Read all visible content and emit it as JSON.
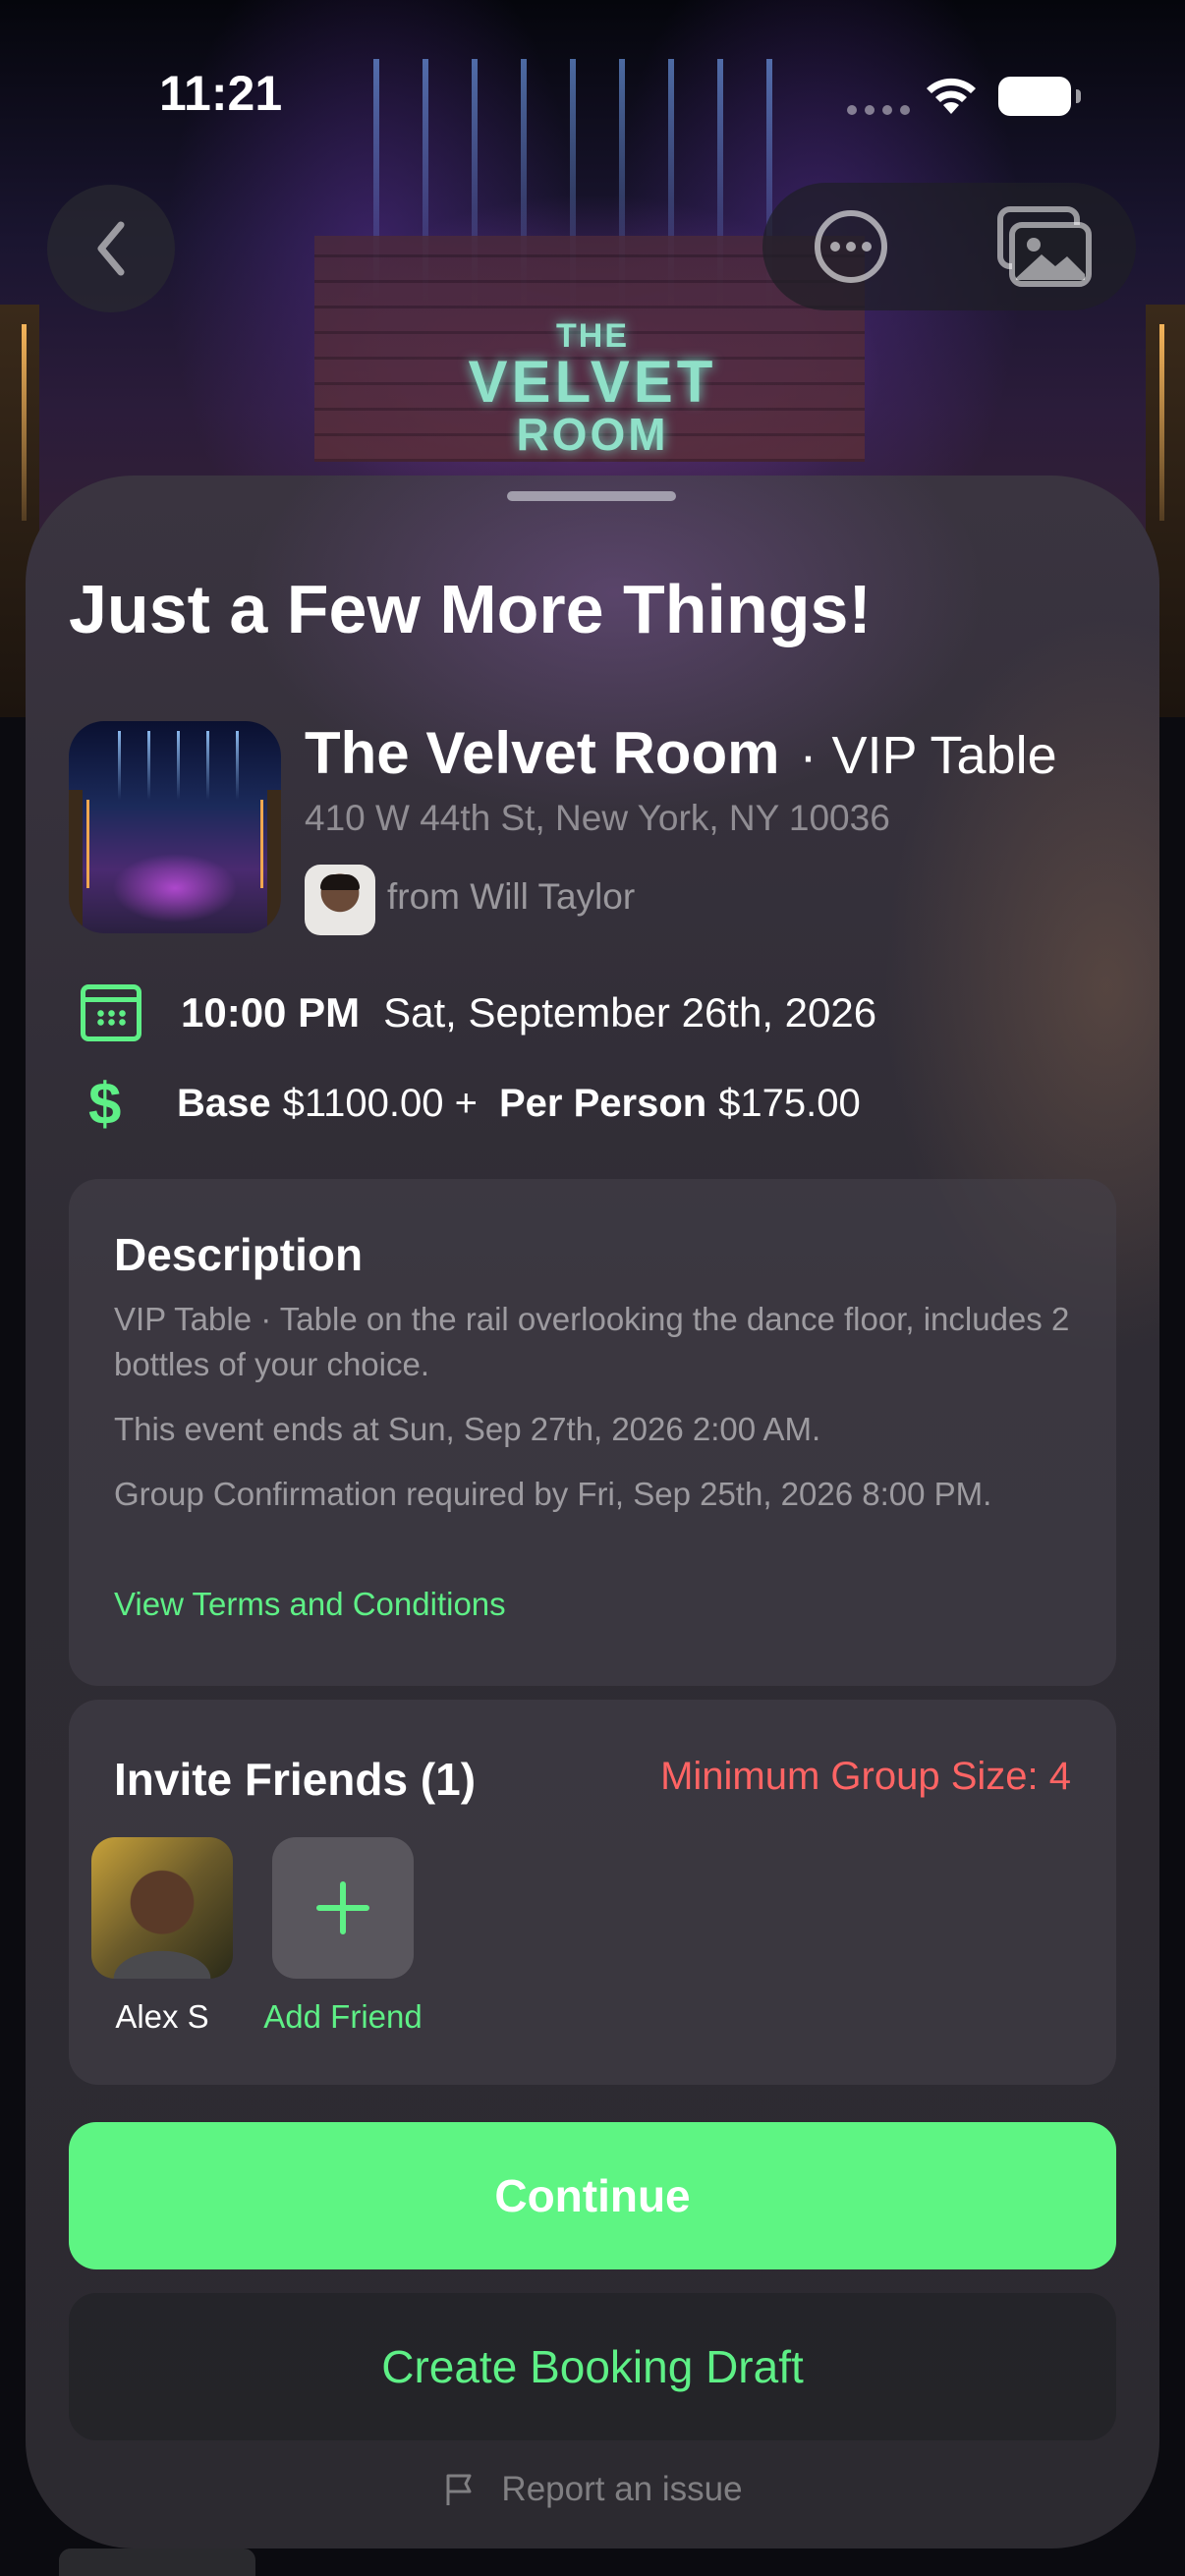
{
  "status_bar": {
    "time": "11:21"
  },
  "hero": {
    "sign_lines": [
      "THE",
      "VELVET",
      "ROOM"
    ]
  },
  "nav": {
    "back_icon": "chevron-left-icon",
    "more_icon": "ellipsis-circle-icon",
    "photos_icon": "photo-gallery-icon"
  },
  "sheet": {
    "title": "Just a Few More Things!",
    "venue": {
      "name": "The Velvet Room",
      "table_type": "· VIP Table",
      "address": "410 W 44th St, New York, NY 10036",
      "host_label": "from Will Taylor"
    },
    "schedule": {
      "time": "10:00 PM",
      "date": "Sat, September 26th, 2026"
    },
    "pricing": {
      "base_label": "Base",
      "base_value": "$1100.00 +",
      "per_person_label": "Per Person",
      "per_person_value": "$175.00"
    },
    "description": {
      "title": "Description",
      "body": "VIP Table · Table on the rail overlooking the dance floor, includes 2 bottles of your choice.",
      "end_note": "This event ends at Sun, Sep 27th, 2026 2:00 AM.",
      "confirmation_note": "Group Confirmation required by Fri, Sep 25th, 2026 8:00 PM.",
      "terms_link": "View Terms and Conditions"
    },
    "invite": {
      "title": "Invite Friends (1)",
      "min_group": "Minimum Group Size: 4",
      "friends": [
        {
          "name": "Alex S"
        }
      ],
      "add_label": "Add Friend"
    },
    "buttons": {
      "continue": "Continue",
      "draft": "Create Booking Draft"
    },
    "report": "Report an issue"
  },
  "colors": {
    "accent_green": "#5ef086",
    "warning_red": "#ff6464",
    "continue_bg": "#5ef583"
  }
}
